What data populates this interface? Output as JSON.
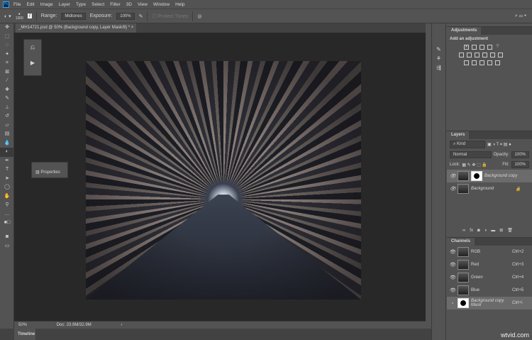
{
  "menu": {
    "items": [
      "File",
      "Edit",
      "Image",
      "Layer",
      "Type",
      "Select",
      "Filter",
      "3D",
      "View",
      "Window",
      "Help"
    ]
  },
  "options": {
    "brush_size": "1300",
    "range_label": "Range:",
    "range_value": "Midtones",
    "exposure_label": "Exposure:",
    "exposure_value": "100%",
    "protect_tones": "Protect Tones"
  },
  "document": {
    "tab_title": "_MH14721.psd @ 50% (Background copy, Layer Mask/8) *"
  },
  "status": {
    "zoom": "50%",
    "doc": "Doc: 23.9M/32.9M"
  },
  "timeline": {
    "label": "Timeline"
  },
  "properties": {
    "label": "Properties"
  },
  "adjustments": {
    "tab": "Adjustments",
    "heading": "Add an adjustment"
  },
  "layers": {
    "tab": "Layers",
    "kind": "Kind",
    "blend": "Normal",
    "opacity_label": "Opacity:",
    "opacity": "100%",
    "lock_label": "Lock:",
    "fill_label": "Fill:",
    "fill": "100%",
    "items": [
      {
        "name": "Background copy"
      },
      {
        "name": "Background"
      }
    ]
  },
  "channels": {
    "tab": "Channels",
    "items": [
      {
        "name": "RGB",
        "shortcut": "Ctrl+2"
      },
      {
        "name": "Red",
        "shortcut": "Ctrl+3"
      },
      {
        "name": "Green",
        "shortcut": "Ctrl+4"
      },
      {
        "name": "Blue",
        "shortcut": "Ctrl+5"
      },
      {
        "name": "Background copy Mask",
        "shortcut": "Ctrl+\\"
      }
    ]
  },
  "watermark": "wtvid.com"
}
